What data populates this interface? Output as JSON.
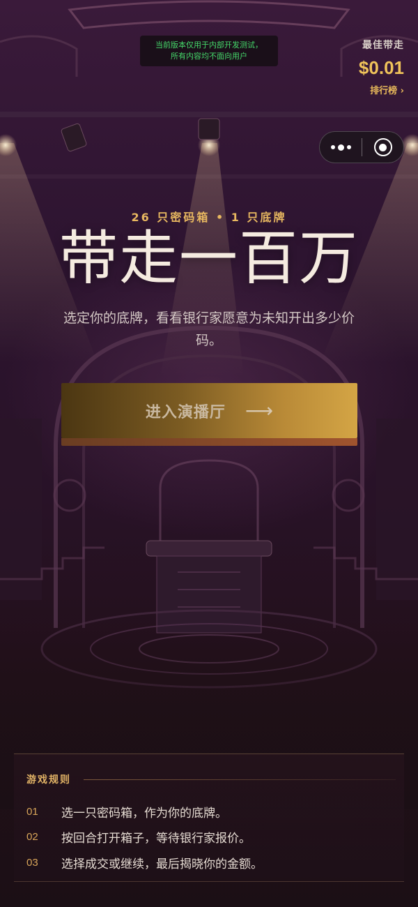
{
  "dev_notice": {
    "line1": "当前版本仅用于内部开发测试，",
    "line2": "所有内容均不面向用户"
  },
  "best": {
    "label": "最佳带走",
    "value": "$0.01",
    "leaderboard_link": "排行榜 ›"
  },
  "capsule": {
    "more_icon": "more-dots-icon",
    "close_icon": "target-close-icon"
  },
  "hero": {
    "subtitle": "26 只密码箱  •  1 只底牌",
    "title": "带走一百万",
    "description": "选定你的底牌，看看银行家愿意为未知开出多少价码。"
  },
  "cta": {
    "label": "进入演播厅",
    "arrow": "⟶"
  },
  "rules": {
    "title": "游戏规则",
    "items": [
      {
        "num": "01",
        "text": "选一只密码箱，作为你的底牌。"
      },
      {
        "num": "02",
        "text": "按回合打开箱子，等待银行家报价。"
      },
      {
        "num": "03",
        "text": "选择成交或继续，最后揭晓你的金额。"
      }
    ]
  },
  "colors": {
    "accent_gold": "#e8b860",
    "notice_green": "#45d86a",
    "background": "#2d1430"
  }
}
